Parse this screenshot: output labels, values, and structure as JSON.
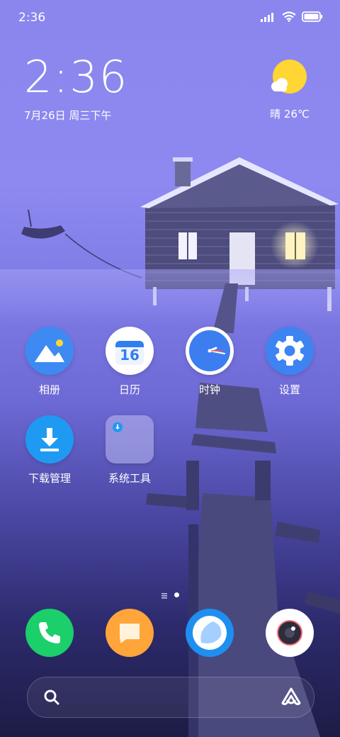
{
  "status_bar": {
    "time": "2:36"
  },
  "clock_widget": {
    "time": "2:36",
    "date": "7月26日 周三下午"
  },
  "weather_widget": {
    "condition": "晴 26℃",
    "icon": "sun-with-cloud-icon"
  },
  "apps": [
    {
      "label": "相册",
      "icon": "gallery-icon"
    },
    {
      "label": "日历",
      "icon": "calendar-icon",
      "day": "16"
    },
    {
      "label": "时钟",
      "icon": "clock-icon"
    },
    {
      "label": "设置",
      "icon": "settings-gear-icon"
    },
    {
      "label": "下载管理",
      "icon": "download-icon"
    },
    {
      "label": "系统工具",
      "icon": "folder-icon"
    }
  ],
  "dock": [
    {
      "icon": "phone-icon"
    },
    {
      "icon": "messages-icon"
    },
    {
      "icon": "browser-icon"
    },
    {
      "icon": "camera-icon"
    }
  ],
  "search_bar": {
    "icon": "search-icon",
    "assistant_icon": "assistant-icon"
  },
  "colors": {
    "accent_blue": "#2f7ff0",
    "wallpaper_top": "#8a86ee",
    "wallpaper_bottom": "#1d1c46"
  }
}
